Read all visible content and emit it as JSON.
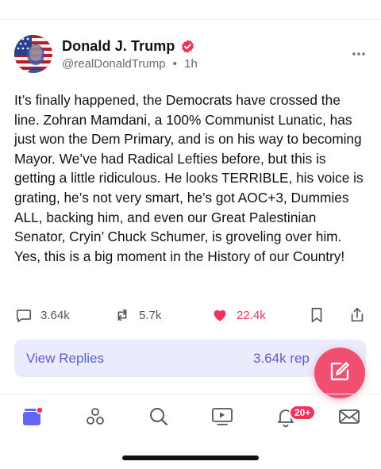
{
  "post": {
    "author": {
      "display_name": "Donald J. Trump",
      "handle": "@realDonaldTrump",
      "separator": "•",
      "time_ago": "1h",
      "verified": true,
      "verified_color": "#f0325c"
    },
    "body": "It’s finally happened, the Democrats have crossed the line. Zohran Mamdani, a 100% Communist Lunatic, has just won the Dem Primary, and is on his way to becoming Mayor. We’ve had Radical Lefties before, but this is getting a little ridiculous. He looks TERRIBLE, his voice is grating, he’s not very smart, he’s got AOC+3, Dummies ALL, backing him, and even our Great Palestinian Senator, Cryin’ Chuck Schumer, is groveling over him. Yes, this is a big moment in the History of our Country!",
    "actions": {
      "replies_count": "3.64k",
      "retruths_count": "5.7k",
      "likes_count": "22.4k",
      "liked": true
    },
    "view_replies": {
      "label": "View Replies",
      "count": "3.64k rep"
    }
  },
  "nav": {
    "notifications_badge": "20+",
    "tabs": [
      "home-icon",
      "groups-icon",
      "search-icon",
      "video-icon",
      "bell-icon",
      "mail-icon"
    ]
  },
  "colors": {
    "accent": "#5a5dcc",
    "like": "#f0325c",
    "fab": "#f14f6f",
    "replies_bg": "#eaebfc"
  }
}
